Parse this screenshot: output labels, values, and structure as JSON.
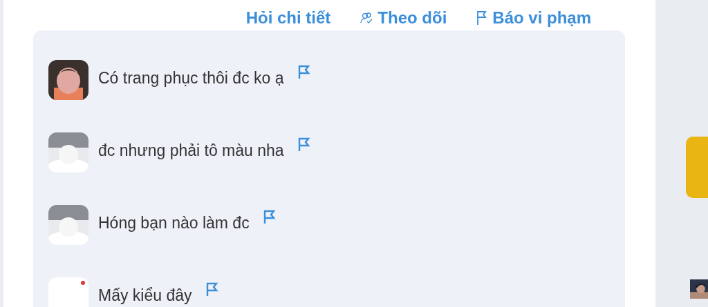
{
  "actions": [
    {
      "kind": "plain",
      "label": "Hỏi chi tiết"
    },
    {
      "kind": "follow",
      "label": "Theo dõi"
    },
    {
      "kind": "report",
      "label": "Báo vi phạm"
    }
  ],
  "comments": [
    {
      "text": "Có trang phục thôi đc ko ạ"
    },
    {
      "text": "đc nhưng phải tô màu nha"
    },
    {
      "text": "Hóng bạn nào làm đc"
    },
    {
      "text": "Mấy kiểu đây"
    }
  ]
}
